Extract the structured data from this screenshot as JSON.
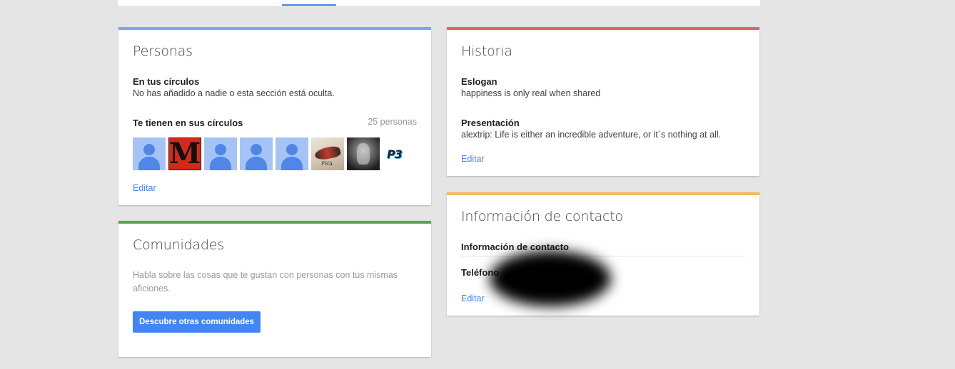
{
  "colors": {
    "personas_accent": "#7ba6f0",
    "comunidades_accent": "#4caa48",
    "historia_accent": "#d9695d",
    "contacto_accent": "#f6b75b",
    "link": "#4285f4",
    "button": "#4285f4"
  },
  "personas": {
    "title": "Personas",
    "in_circles_label": "En tus círculos",
    "in_circles_text": "No has añadido a nadie o esta sección está oculta.",
    "have_you_label": "Te tienen en sus círculos",
    "have_you_count": "25 personas",
    "avatars": [
      {
        "icon": "default-person-avatar"
      },
      {
        "icon": "red-m-logo-avatar",
        "glyph": "M"
      },
      {
        "icon": "default-person-avatar"
      },
      {
        "icon": "default-person-avatar"
      },
      {
        "icon": "default-person-avatar"
      },
      {
        "icon": "shoe-photo-avatar"
      },
      {
        "icon": "dark-figure-photo-avatar"
      },
      {
        "icon": "p3-logo-avatar",
        "glyph": "P3"
      }
    ],
    "edit_label": "Editar"
  },
  "comunidades": {
    "title": "Comunidades",
    "description": "Habla sobre las cosas que te gustan con personas con tus mismas aficiones.",
    "button_label": "Descubre otras comunidades"
  },
  "historia": {
    "title": "Historia",
    "eslogan_label": "Eslogan",
    "eslogan_text": "happiness is only real when shared",
    "presentacion_label": "Presentación",
    "presentacion_text": "alextrip: Life is either an incredible adventure, or it´s nothing at all.",
    "edit_label": "Editar"
  },
  "contacto": {
    "title": "Información de contacto",
    "section_label": "Información de contacto",
    "phone_label": "Teléfono",
    "edit_label": "Editar"
  }
}
